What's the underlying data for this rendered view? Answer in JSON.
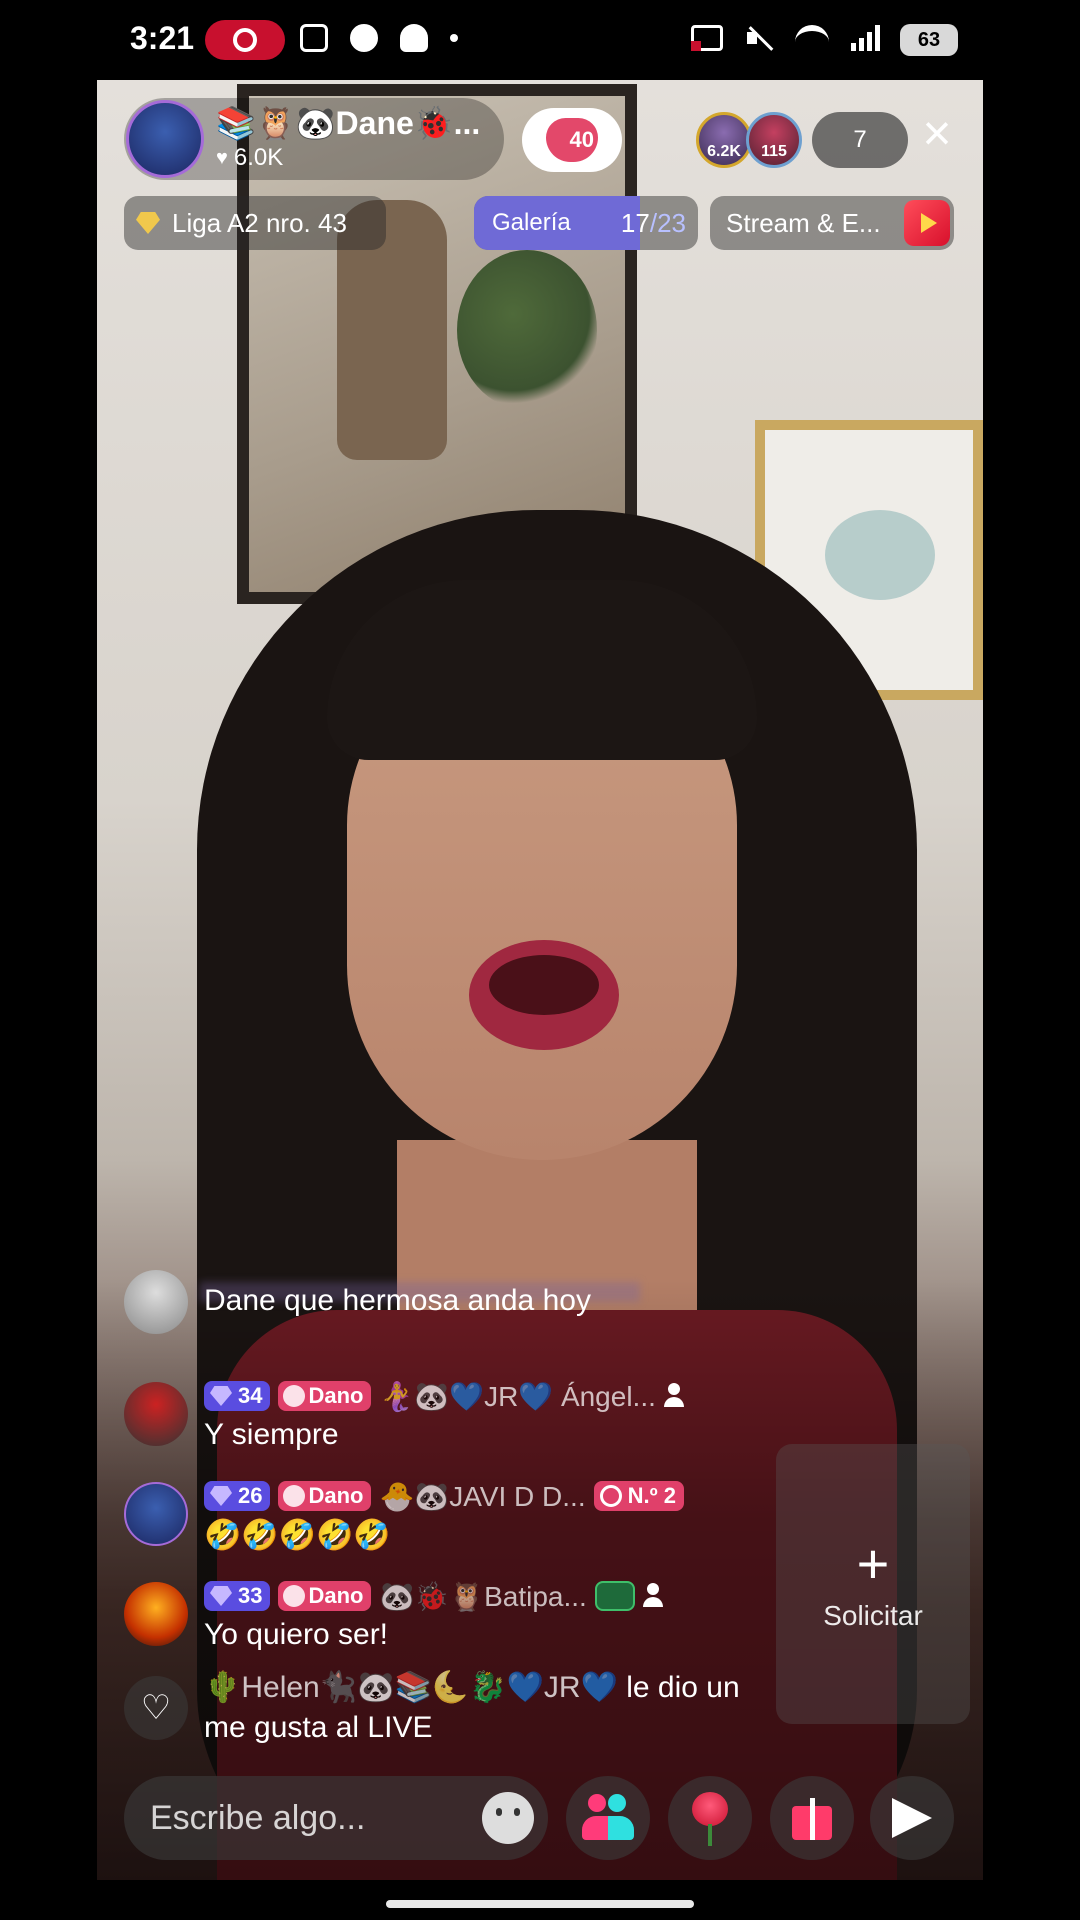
{
  "status_bar": {
    "time": "3:21",
    "battery": "63",
    "icons_left": [
      "screen-record-icon",
      "screenshot-icon",
      "account-icon",
      "snapchat-icon",
      "notification-dot-icon"
    ],
    "icons_right": [
      "cast-icon",
      "mute-icon",
      "wifi-icon",
      "signal-icon",
      "battery-icon"
    ]
  },
  "host": {
    "name": "📚🦉🐼Dane🐞...",
    "likes": "6.0K",
    "follow_badge": "40"
  },
  "viewers": {
    "top": [
      {
        "count": "6.2K"
      },
      {
        "count": "115"
      }
    ],
    "total": "7"
  },
  "close_icon": "×",
  "pills": {
    "league": "Liga A2 nro. 43",
    "gallery_label": "Galería",
    "gallery_done": "17",
    "gallery_total": "/23",
    "gallery_progress": 0.74,
    "stream": "Stream & E..."
  },
  "chat": {
    "messages": [
      {
        "text": "Dane que hermosa anda hoy"
      },
      {
        "level": "34",
        "fan": "Dano",
        "user": "🧜‍♀️🐼💙JR💙 Ángel...",
        "text": "Y siempre"
      },
      {
        "level": "26",
        "fan": "Dano",
        "user": "🐣🐼JAVI D D...",
        "rank": "N.º 2",
        "text": "🤣🤣🤣🤣🤣"
      },
      {
        "level": "33",
        "fan": "Dano",
        "user": "🐼🐞🦉Batipa...",
        "text": "Yo quiero ser!"
      }
    ],
    "like_notice": {
      "user": "🌵Helen🐈‍⬛🐼📚🌜🐉💙JR💙",
      "action": " le dio un me gusta al LIVE"
    }
  },
  "request": {
    "plus": "+",
    "label": "Solicitar"
  },
  "composer": {
    "placeholder": "Escribe algo..."
  },
  "colors": {
    "level_badge": "#5a4de0",
    "fan_badge": "#e0406a",
    "gallery_fill": "#6f6ad6",
    "record_red": "#c8102e"
  }
}
